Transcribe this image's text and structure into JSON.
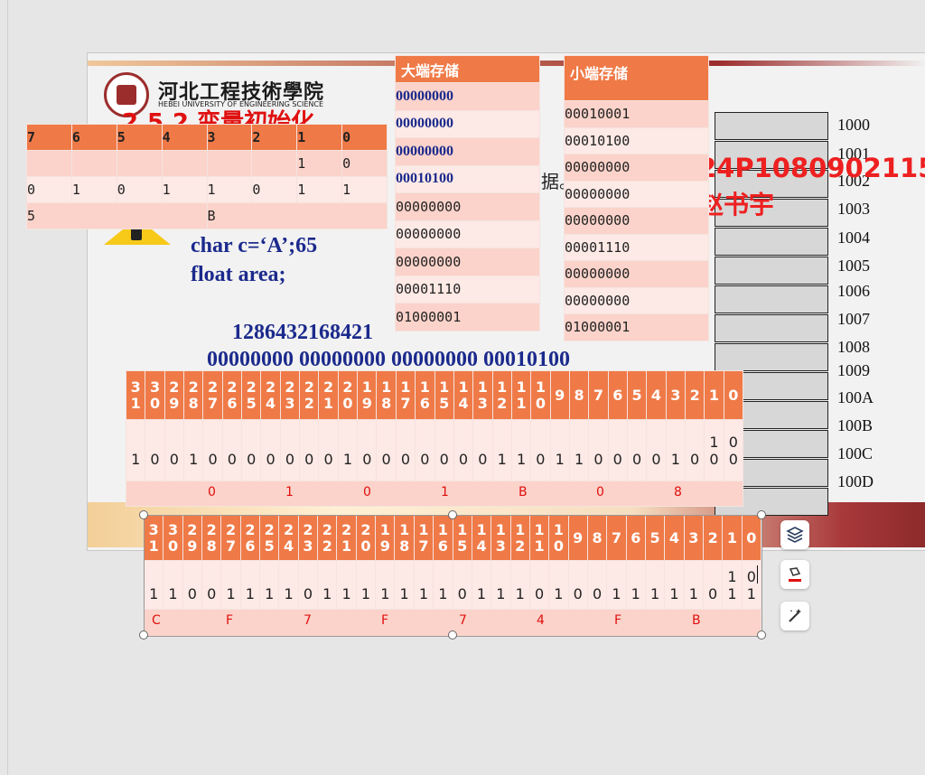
{
  "slide": {
    "logo_cn": "河北工程技術學院",
    "logo_en": "HEBEI UNIVERSITY OF ENGINEERING SCIENCE",
    "heading": "2.5.2 变量初始化",
    "partial_text": "据。",
    "code_lines": [
      "char c=‘A’;65",
      "float area;"
    ],
    "weights": "1286432168421",
    "binary_groups": "00000000 00000000 00000000 00010100",
    "address_labels": [
      "1000",
      "1001",
      "1002",
      "1003",
      "1004",
      "1005",
      "1006",
      "1007",
      "1008",
      "1009",
      "100A",
      "100B",
      "100C",
      "100D"
    ],
    "student_id": "24P1080902115",
    "student_name": "赵书宇"
  },
  "bit_table": {
    "headers": [
      "7",
      "6",
      "5",
      "4",
      "3",
      "2",
      "1",
      "0"
    ],
    "row1": [
      "",
      "",
      "",
      "",
      "",
      "",
      "1",
      "0"
    ],
    "row2": [
      "0",
      "1",
      "0",
      "1",
      "1",
      "0",
      "1",
      "1"
    ],
    "row3_left": "5",
    "row3_right": "B"
  },
  "big_endian": {
    "title": "大端存储",
    "rows": [
      "00000000",
      "00000000",
      "00000000",
      "00010100",
      "00000000",
      "00000000",
      "00000000",
      "00001110",
      "01000001"
    ]
  },
  "little_endian": {
    "title": "小端存储",
    "rows": [
      "00010001",
      "00010100",
      "00000000",
      "00000000",
      "00000000",
      "00001110",
      "00000000",
      "00000000",
      "01000001"
    ]
  },
  "table32_a": {
    "headers": [
      "31",
      "30",
      "29",
      "28",
      "27",
      "26",
      "25",
      "24",
      "23",
      "22",
      "21",
      "20",
      "19",
      "18",
      "17",
      "16",
      "15",
      "14",
      "13",
      "12",
      "11",
      "10",
      "9",
      "8",
      "7",
      "6",
      "5",
      "4",
      "3",
      "2",
      "1",
      "0"
    ],
    "bits": [
      "1",
      "0",
      "0",
      "1",
      "0",
      "0",
      "0",
      "0",
      "0",
      "0",
      "0",
      "1",
      "0",
      "0",
      "0",
      "0",
      "0",
      "0",
      "0",
      "1",
      "1",
      "0",
      "1",
      "1",
      "0",
      "0",
      "0",
      "0",
      "1",
      "0",
      "0",
      "0"
    ],
    "bits_top": [
      "",
      "",
      "",
      "",
      "",
      "",
      "",
      "",
      "",
      "",
      "",
      "",
      "",
      "",
      "",
      "",
      "",
      "",
      "",
      "",
      "",
      "",
      "",
      "",
      "",
      "",
      "",
      "",
      "",
      "",
      "1",
      "0"
    ],
    "hex": [
      "0",
      "1",
      "0",
      "1",
      "B",
      "0",
      "8"
    ]
  },
  "table32_b": {
    "headers": [
      "31",
      "30",
      "29",
      "28",
      "27",
      "26",
      "25",
      "24",
      "23",
      "22",
      "21",
      "20",
      "19",
      "18",
      "17",
      "16",
      "15",
      "14",
      "13",
      "12",
      "11",
      "10",
      "9",
      "8",
      "7",
      "6",
      "5",
      "4",
      "3",
      "2",
      "1",
      "0"
    ],
    "bits": [
      "1",
      "1",
      "0",
      "0",
      "1",
      "1",
      "1",
      "1",
      "0",
      "1",
      "1",
      "1",
      "1",
      "1",
      "1",
      "1",
      "0",
      "1",
      "1",
      "1",
      "0",
      "1",
      "0",
      "0",
      "1",
      "1",
      "1",
      "1",
      "1",
      "0",
      "1",
      "1"
    ],
    "bits_top": [
      "",
      "",
      "",
      "",
      "",
      "",
      "",
      "",
      "",
      "",
      "",
      "",
      "",
      "",
      "",
      "",
      "",
      "",
      "",
      "",
      "",
      "",
      "",
      "",
      "",
      "",
      "",
      "",
      "",
      "",
      "1",
      "0"
    ],
    "hex": [
      "C",
      "F",
      "7",
      "F",
      "7",
      "4",
      "F",
      "B"
    ]
  },
  "toolbar": {
    "icons": [
      "layers-icon",
      "paint-format-icon",
      "magic-wand-icon"
    ]
  }
}
